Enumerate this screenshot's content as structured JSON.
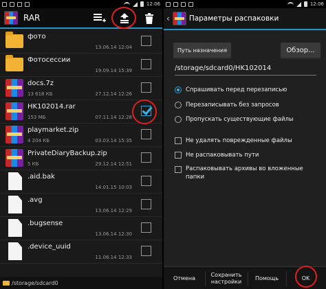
{
  "left": {
    "statusbar": {
      "time": "12:06"
    },
    "toolbar": {
      "title": "RAR"
    },
    "files": [
      {
        "kind": "folder",
        "name": "фото",
        "size": "",
        "date": "13.06.14 12:04",
        "checked": false
      },
      {
        "kind": "folder",
        "name": "Фотосессии",
        "size": "",
        "date": "19.09.14 15:39",
        "checked": false
      },
      {
        "kind": "archive",
        "name": "docs.7z",
        "size": "13 618 КБ",
        "date": "27.12.14 12:26",
        "checked": false
      },
      {
        "kind": "archive",
        "name": "HK102014.rar",
        "size": "153 МБ",
        "date": "07.11.14 12:28",
        "checked": true
      },
      {
        "kind": "archive",
        "name": "playmarket.zip",
        "size": "4 204 КБ",
        "date": "03.03.14 15:35",
        "checked": false
      },
      {
        "kind": "archive",
        "name": "PrivateDiaryBackup.zip",
        "size": "5 КБ",
        "date": "29.12.14 12:51",
        "checked": false
      },
      {
        "kind": "doc",
        "name": ".aid.bak",
        "size": "",
        "date": "14.01.15 10:03",
        "checked": false
      },
      {
        "kind": "doc",
        "name": ".avg",
        "size": "",
        "date": "13.06.14 12:29",
        "checked": false
      },
      {
        "kind": "doc",
        "name": ".bugsense",
        "size": "",
        "date": "13.06.14 12:30",
        "checked": false
      },
      {
        "kind": "doc",
        "name": ".device_uuid",
        "size": "",
        "date": "11.06.14 12:33",
        "checked": false
      }
    ],
    "path": "/storage/sdcard0"
  },
  "right": {
    "statusbar": {
      "time": "12:06"
    },
    "title": "Параметры распаковки",
    "dest_button": "Путь назначения",
    "browse_button": "Обзор...",
    "dest_path": "/storage/sdcard0/HK102014",
    "overwrite_options": [
      {
        "label": "Спрашивать перед перезаписью",
        "selected": true
      },
      {
        "label": "Перезаписывать без запросов",
        "selected": false
      },
      {
        "label": "Пропускать существующие файлы",
        "selected": false
      }
    ],
    "checkbox_options": [
      {
        "label": "Не удалять поврежденные файлы",
        "checked": false
      },
      {
        "label": "Не распаковывать пути",
        "checked": false
      },
      {
        "label": "Распаковывать архивы во вложенные папки",
        "checked": false
      }
    ],
    "buttons": {
      "cancel": "Отмена",
      "save": "Сохранить настройки",
      "help": "Помощь",
      "ok": "OK"
    }
  },
  "colors": {
    "accent": "#2196c9",
    "highlight": "#e02020"
  }
}
